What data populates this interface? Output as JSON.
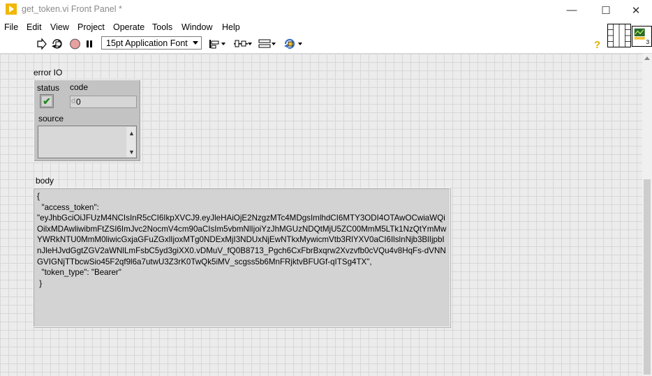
{
  "window": {
    "title": "get_token.vi Front Panel *",
    "minimize_glyph": "—",
    "maximize_glyph": "☐",
    "close_glyph": "✕"
  },
  "menu": [
    "File",
    "Edit",
    "View",
    "Project",
    "Operate",
    "Tools",
    "Window",
    "Help"
  ],
  "toolbar": {
    "font_select": "15pt Application Font",
    "icons": [
      "run-arrow-icon",
      "run-continuously-icon",
      "abort-icon",
      "pause-icon",
      "align-objects-icon",
      "distribute-objects-icon",
      "resize-objects-icon",
      "reorder-icon",
      "help-icon"
    ]
  },
  "front_panel": {
    "error_io": {
      "label": "error IO",
      "status_label": "status",
      "status_value": "✔",
      "code_label": "code",
      "code_radix": "d",
      "code_value": "0",
      "source_label": "source",
      "source_value": ""
    },
    "body": {
      "label": "body",
      "text": "{\n  \"access_token\":\n\"eyJhbGciOiJFUzM4NCIsInR5cCI6IkpXVCJ9.eyJleHAiOjE2NzgzMTc4MDgsImlhdCI6MTY3ODI4OTAwOCwiaWQiOilxMDAwliwibmFtZSI6ImJvc2NocmV4cm90aCIsIm5vbmNlIjoiYzJhMGUzNDQtMjU5ZC00MmM5LTk1NzQtYmMwYWRkNTU0MmM0liwicGxjaGFuZGxlIjoxMTg0NDExMjI3NDUxNjEwNTkxMywicmVtb3RlYXV0aCI6IlslnNjb3BlIjpbInJleHJvdGgtZGV2aWNlLmFsbC5yd3giXX0.vDMuV_fQ0B8713_Pgch6CxFbrBxqrw2Xvzvfb0cVQu4v8HqFs-dVNNGVIGNjTTbcwSio45F2qf9l6a7utwU3Z3rK0TwQk5iMV_scgss5b6MnFRjktvBFUGf-qITSg4TX\",\n  \"token_type\": \"Bearer\"\n }"
    }
  }
}
